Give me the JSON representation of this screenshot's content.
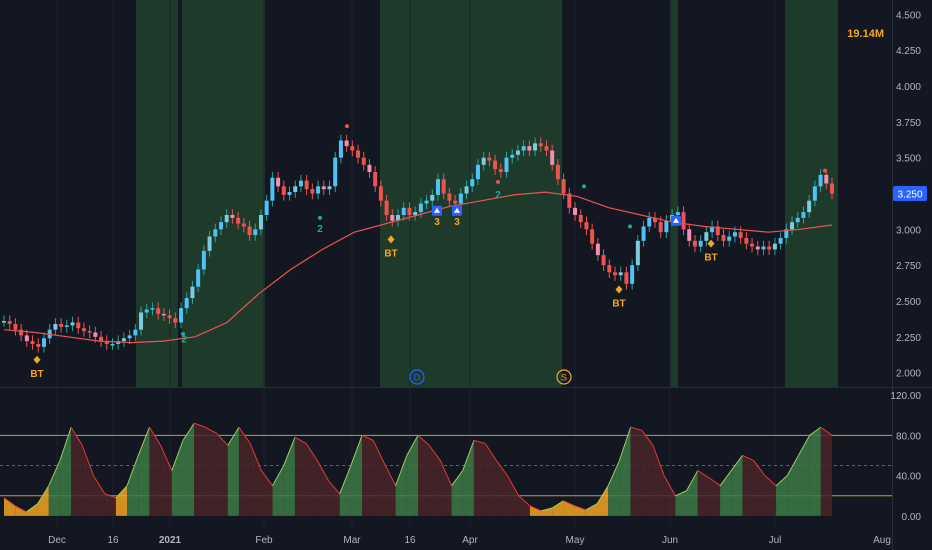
{
  "volume_label": "19.14M",
  "last_price_label": "3.250",
  "colors": {
    "background": "#131722",
    "up": "#26a69a",
    "up_body_light": "#7ecbe0",
    "down": "#ef5350",
    "green_band": "#1e3a2a",
    "ma_line": "#ef5350",
    "accent_orange": "#f5a623",
    "price_label_bg": "#2962ff"
  },
  "price_axis_labels": [
    "4.500",
    "4.250",
    "4.000",
    "3.750",
    "3.500",
    "3.250",
    "3.000",
    "2.750",
    "2.500",
    "2.250",
    "2.000"
  ],
  "osc_axis_labels": [
    "120.00",
    "80.00",
    "40.00",
    "0.00"
  ],
  "time_axis_labels": [
    "Dec",
    "16",
    "2021",
    "Feb",
    "Mar",
    "16",
    "Apr",
    "May",
    "Jun",
    "Jul",
    "Aug"
  ],
  "markers": {
    "bt": [
      "BT",
      "BT",
      "BT",
      "BT"
    ],
    "counts": [
      "2",
      "2",
      "3",
      "3",
      "2"
    ],
    "event_d": "D",
    "event_s": "S"
  },
  "chart_data": {
    "type": "candlestick",
    "title": "",
    "price_ylim": [
      1.9,
      4.6
    ],
    "oscillator_ylim": [
      -10,
      125
    ],
    "oscillator_levels": [
      20,
      50,
      80
    ],
    "time_ticks": [
      "Dec",
      "16",
      "2021",
      "Feb",
      "Mar",
      "16",
      "Apr",
      "May",
      "Jun",
      "Jul",
      "Aug"
    ],
    "closes": [
      2.36,
      2.34,
      2.3,
      2.26,
      2.22,
      2.2,
      2.18,
      2.24,
      2.3,
      2.34,
      2.32,
      2.33,
      2.35,
      2.31,
      2.29,
      2.28,
      2.25,
      2.22,
      2.2,
      2.2,
      2.22,
      2.24,
      2.26,
      2.3,
      2.42,
      2.44,
      2.45,
      2.41,
      2.4,
      2.38,
      2.35,
      2.45,
      2.52,
      2.6,
      2.72,
      2.85,
      2.95,
      3.0,
      3.05,
      3.1,
      3.08,
      3.04,
      3.02,
      2.96,
      3.0,
      3.1,
      3.2,
      3.36,
      3.3,
      3.24,
      3.26,
      3.3,
      3.34,
      3.28,
      3.25,
      3.3,
      3.28,
      3.3,
      3.5,
      3.62,
      3.58,
      3.55,
      3.5,
      3.45,
      3.4,
      3.3,
      3.2,
      3.1,
      3.06,
      3.1,
      3.15,
      3.1,
      3.12,
      3.18,
      3.2,
      3.24,
      3.35,
      3.25,
      3.2,
      3.18,
      3.25,
      3.3,
      3.35,
      3.45,
      3.5,
      3.48,
      3.42,
      3.4,
      3.5,
      3.52,
      3.55,
      3.58,
      3.55,
      3.6,
      3.58,
      3.55,
      3.45,
      3.35,
      3.25,
      3.15,
      3.1,
      3.05,
      3.0,
      2.9,
      2.82,
      2.75,
      2.7,
      2.68,
      2.7,
      2.62,
      2.75,
      2.92,
      3.02,
      3.08,
      3.05,
      2.98,
      3.06,
      3.1,
      3.12,
      3.0,
      2.92,
      2.88,
      2.92,
      2.98,
      3.02,
      2.96,
      2.92,
      2.95,
      2.98,
      2.94,
      2.9,
      2.88,
      2.86,
      2.88,
      2.86,
      2.9,
      2.94,
      3.0,
      3.05,
      3.08,
      3.12,
      3.2,
      3.3,
      3.38,
      3.32,
      3.25
    ],
    "moving_average": [
      2.3,
      2.28,
      2.25,
      2.22,
      2.21,
      2.22,
      2.25,
      2.35,
      2.55,
      2.72,
      2.86,
      2.98,
      3.04,
      3.1,
      3.16,
      3.2,
      3.24,
      3.26,
      3.23,
      3.15,
      3.1,
      3.05,
      3.02,
      3.0,
      2.98,
      3.0,
      3.03
    ],
    "oscillator": [
      18,
      10,
      4,
      12,
      30,
      55,
      88,
      70,
      40,
      22,
      18,
      30,
      60,
      88,
      70,
      45,
      75,
      92,
      88,
      82,
      70,
      88,
      72,
      45,
      30,
      50,
      78,
      72,
      55,
      35,
      22,
      50,
      80,
      75,
      52,
      30,
      60,
      80,
      70,
      55,
      30,
      45,
      75,
      72,
      55,
      40,
      20,
      10,
      5,
      8,
      15,
      10,
      6,
      12,
      30,
      55,
      88,
      85,
      70,
      40,
      20,
      25,
      45,
      38,
      30,
      45,
      60,
      55,
      40,
      30,
      40,
      60,
      80,
      88,
      80
    ]
  }
}
